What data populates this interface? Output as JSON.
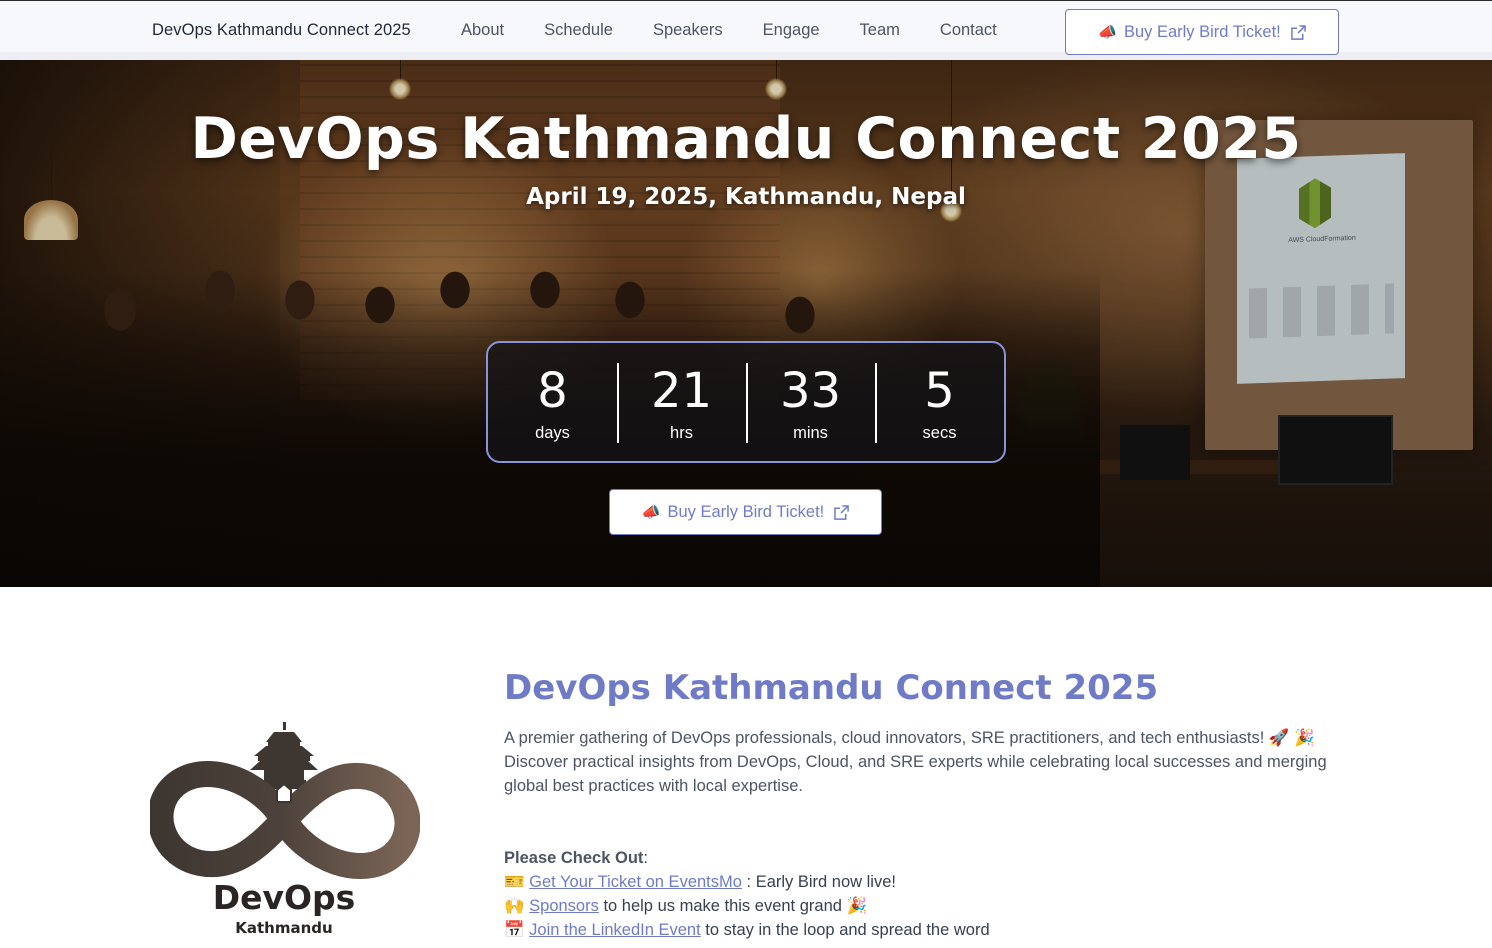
{
  "nav": {
    "brand": "DevOps Kathmandu Connect 2025",
    "links": [
      "About",
      "Schedule",
      "Speakers",
      "Engage",
      "Team",
      "Contact"
    ],
    "cta_label": "Buy Early Bird Ticket!",
    "cta_icon": "megaphone-icon"
  },
  "hero": {
    "title": "DevOps Kathmandu Connect 2025",
    "subtitle": "April 19, 2025, Kathmandu, Nepal",
    "countdown": [
      {
        "value": "8",
        "unit": "days"
      },
      {
        "value": "21",
        "unit": "hrs"
      },
      {
        "value": "33",
        "unit": "mins"
      },
      {
        "value": "5",
        "unit": "secs"
      }
    ],
    "cta_label": "Buy Early Bird Ticket!",
    "background_desc_screen_text": "AWS CloudFormation"
  },
  "about": {
    "logo_main": "DevOps",
    "logo_sub": "Kathmandu",
    "title": "DevOps Kathmandu Connect 2025",
    "line1": "A premier gathering of DevOps professionals, cloud innovators, SRE practitioners, and tech enthusiasts! 🚀 🎉",
    "line2": "Discover practical insights from DevOps, Cloud, and SRE experts while celebrating local successes and merging global best practices with local expertise.",
    "checkout_heading": "Please Check Out",
    "checkout_colon": ":",
    "items": [
      {
        "emoji": "🎫",
        "link": "Get Your Ticket on EventsMo",
        "text": " : Early Bird now live!"
      },
      {
        "emoji": "🙌",
        "link": "Sponsors",
        "text": " to help us make this event grand 🎉"
      },
      {
        "emoji": "📅",
        "link": "Join the LinkedIn Event",
        "text": " to stay in the loop and spread the word"
      }
    ]
  },
  "colors": {
    "accent": "#6f7bc7",
    "text": "#4b5563",
    "logo_dark": "#2a2522"
  }
}
